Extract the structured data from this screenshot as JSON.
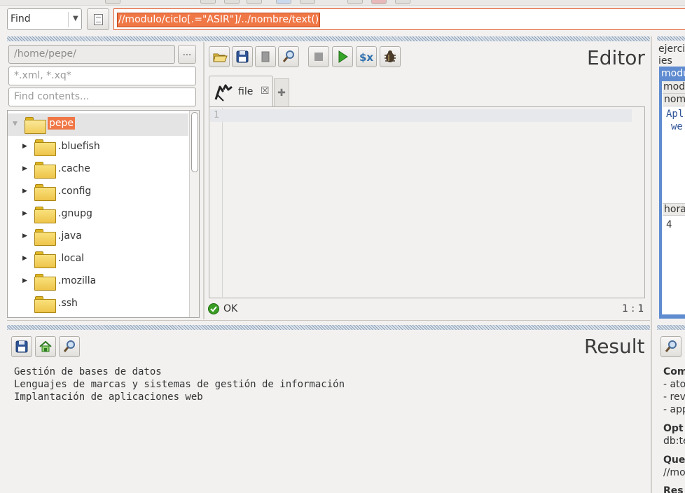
{
  "query_bar": {
    "mode": "Find",
    "query": "//modulo/ciclo[.=\"ASIR\"]/../nombre/text()"
  },
  "file_browser": {
    "path": "/home/pepe/",
    "browse_label": "...",
    "filter_placeholder": "*.xml, *.xq*",
    "contents_placeholder": "Find contents...",
    "tree": [
      {
        "label": "pepe",
        "expanded": true,
        "selected": true
      },
      {
        "label": ".bluefish"
      },
      {
        "label": ".cache"
      },
      {
        "label": ".config"
      },
      {
        "label": ".gnupg"
      },
      {
        "label": ".java"
      },
      {
        "label": ".local"
      },
      {
        "label": ".mozilla"
      },
      {
        "label": ".ssh"
      }
    ]
  },
  "editor": {
    "title": "Editor",
    "tab_label": "file",
    "line_number": "1",
    "status": "OK",
    "position": "1 : 1"
  },
  "right_top": {
    "lines": [
      "ejerci",
      "ies",
      "modu",
      "mod",
      "nom",
      "Apl",
      "we",
      "hora",
      "4"
    ]
  },
  "result": {
    "title": "Result",
    "lines": [
      "Gestión de bases de datos",
      "Lenguajes de marcas y sistemas de gestión de información",
      "Implantación de aplicaciones web"
    ]
  },
  "right_bottom": {
    "lines": [
      "Com",
      "- ato",
      "- rev",
      "- app",
      "Opt",
      "db:te",
      "Que",
      "//mo",
      "Res"
    ]
  },
  "colors": {
    "accent": "#f07746",
    "selection_blue": "#5f8cd0",
    "ok_green": "#3a9d23"
  }
}
